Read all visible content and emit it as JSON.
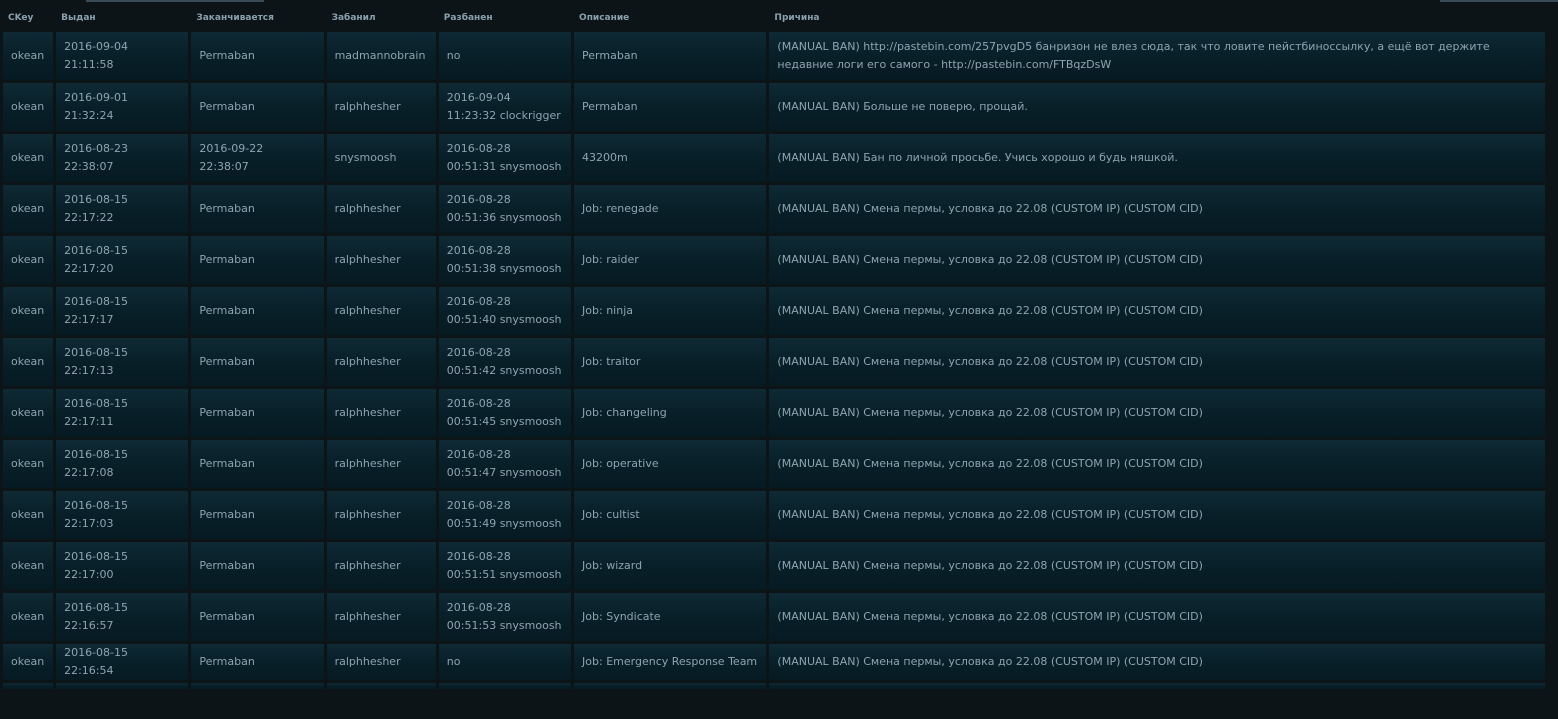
{
  "columns": [
    "CKey",
    "Выдан",
    "Заканчивается",
    "Забанил",
    "Разбанен",
    "Описание",
    "Причина"
  ],
  "rows": [
    {
      "ckey": "okean",
      "issued": "2016-09-04 21:11:58",
      "expires": "Permaban",
      "banned_by": "madmannobrain",
      "unbanned": "no",
      "description": "Permaban",
      "reason": "(MANUAL BAN) http://pastebin.com/257pvgD5 банризон не влез сюда, так что ловите пейстбиноссылку, а ещё вот держите недавние логи его самого - http://pastebin.com/FTBqzDsW"
    },
    {
      "ckey": "okean",
      "issued": "2016-09-01 21:32:24",
      "expires": "Permaban",
      "banned_by": "ralphhesher",
      "unbanned": "2016-09-04 11:23:32 clockrigger",
      "description": "Permaban",
      "reason": "(MANUAL BAN) Больше не поверю, прощай."
    },
    {
      "ckey": "okean",
      "issued": "2016-08-23 22:38:07",
      "expires": "2016-09-22 22:38:07",
      "banned_by": "snysmoosh",
      "unbanned": "2016-08-28 00:51:31 snysmoosh",
      "description": "43200m",
      "reason": "(MANUAL BAN) Бан по личной просьбе. Учись хорошо и будь няшкой."
    },
    {
      "ckey": "okean",
      "issued": "2016-08-15 22:17:22",
      "expires": "Permaban",
      "banned_by": "ralphhesher",
      "unbanned": "2016-08-28 00:51:36 snysmoosh",
      "description": "Job: renegade",
      "reason": "(MANUAL BAN) Смена пермы, условка до 22.08 (CUSTOM IP) (CUSTOM CID)"
    },
    {
      "ckey": "okean",
      "issued": "2016-08-15 22:17:20",
      "expires": "Permaban",
      "banned_by": "ralphhesher",
      "unbanned": "2016-08-28 00:51:38 snysmoosh",
      "description": "Job: raider",
      "reason": "(MANUAL BAN) Смена пермы, условка до 22.08 (CUSTOM IP) (CUSTOM CID)"
    },
    {
      "ckey": "okean",
      "issued": "2016-08-15 22:17:17",
      "expires": "Permaban",
      "banned_by": "ralphhesher",
      "unbanned": "2016-08-28 00:51:40 snysmoosh",
      "description": "Job: ninja",
      "reason": "(MANUAL BAN) Смена пермы, условка до 22.08 (CUSTOM IP) (CUSTOM CID)"
    },
    {
      "ckey": "okean",
      "issued": "2016-08-15 22:17:13",
      "expires": "Permaban",
      "banned_by": "ralphhesher",
      "unbanned": "2016-08-28 00:51:42 snysmoosh",
      "description": "Job: traitor",
      "reason": "(MANUAL BAN) Смена пермы, условка до 22.08 (CUSTOM IP) (CUSTOM CID)"
    },
    {
      "ckey": "okean",
      "issued": "2016-08-15 22:17:11",
      "expires": "Permaban",
      "banned_by": "ralphhesher",
      "unbanned": "2016-08-28 00:51:45 snysmoosh",
      "description": "Job: changeling",
      "reason": "(MANUAL BAN) Смена пермы, условка до 22.08 (CUSTOM IP) (CUSTOM CID)"
    },
    {
      "ckey": "okean",
      "issued": "2016-08-15 22:17:08",
      "expires": "Permaban",
      "banned_by": "ralphhesher",
      "unbanned": "2016-08-28 00:51:47 snysmoosh",
      "description": "Job: operative",
      "reason": "(MANUAL BAN) Смена пермы, условка до 22.08 (CUSTOM IP) (CUSTOM CID)"
    },
    {
      "ckey": "okean",
      "issued": "2016-08-15 22:17:03",
      "expires": "Permaban",
      "banned_by": "ralphhesher",
      "unbanned": "2016-08-28 00:51:49 snysmoosh",
      "description": "Job: cultist",
      "reason": "(MANUAL BAN) Смена пермы, условка до 22.08 (CUSTOM IP) (CUSTOM CID)"
    },
    {
      "ckey": "okean",
      "issued": "2016-08-15 22:17:00",
      "expires": "Permaban",
      "banned_by": "ralphhesher",
      "unbanned": "2016-08-28 00:51:51 snysmoosh",
      "description": "Job: wizard",
      "reason": "(MANUAL BAN) Смена пермы, условка до 22.08 (CUSTOM IP) (CUSTOM CID)"
    },
    {
      "ckey": "okean",
      "issued": "2016-08-15 22:16:57",
      "expires": "Permaban",
      "banned_by": "ralphhesher",
      "unbanned": "2016-08-28 00:51:53 snysmoosh",
      "description": "Job: Syndicate",
      "reason": "(MANUAL BAN) Смена пермы, условка до 22.08 (CUSTOM IP) (CUSTOM CID)"
    },
    {
      "ckey": "okean",
      "issued": "2016-08-15 22:16:54",
      "expires": "Permaban",
      "banned_by": "ralphhesher",
      "unbanned": "no",
      "description": "Job: Emergency Response Team",
      "reason": "(MANUAL BAN) Смена пермы, условка до 22.08 (CUSTOM IP) (CUSTOM CID)"
    }
  ]
}
